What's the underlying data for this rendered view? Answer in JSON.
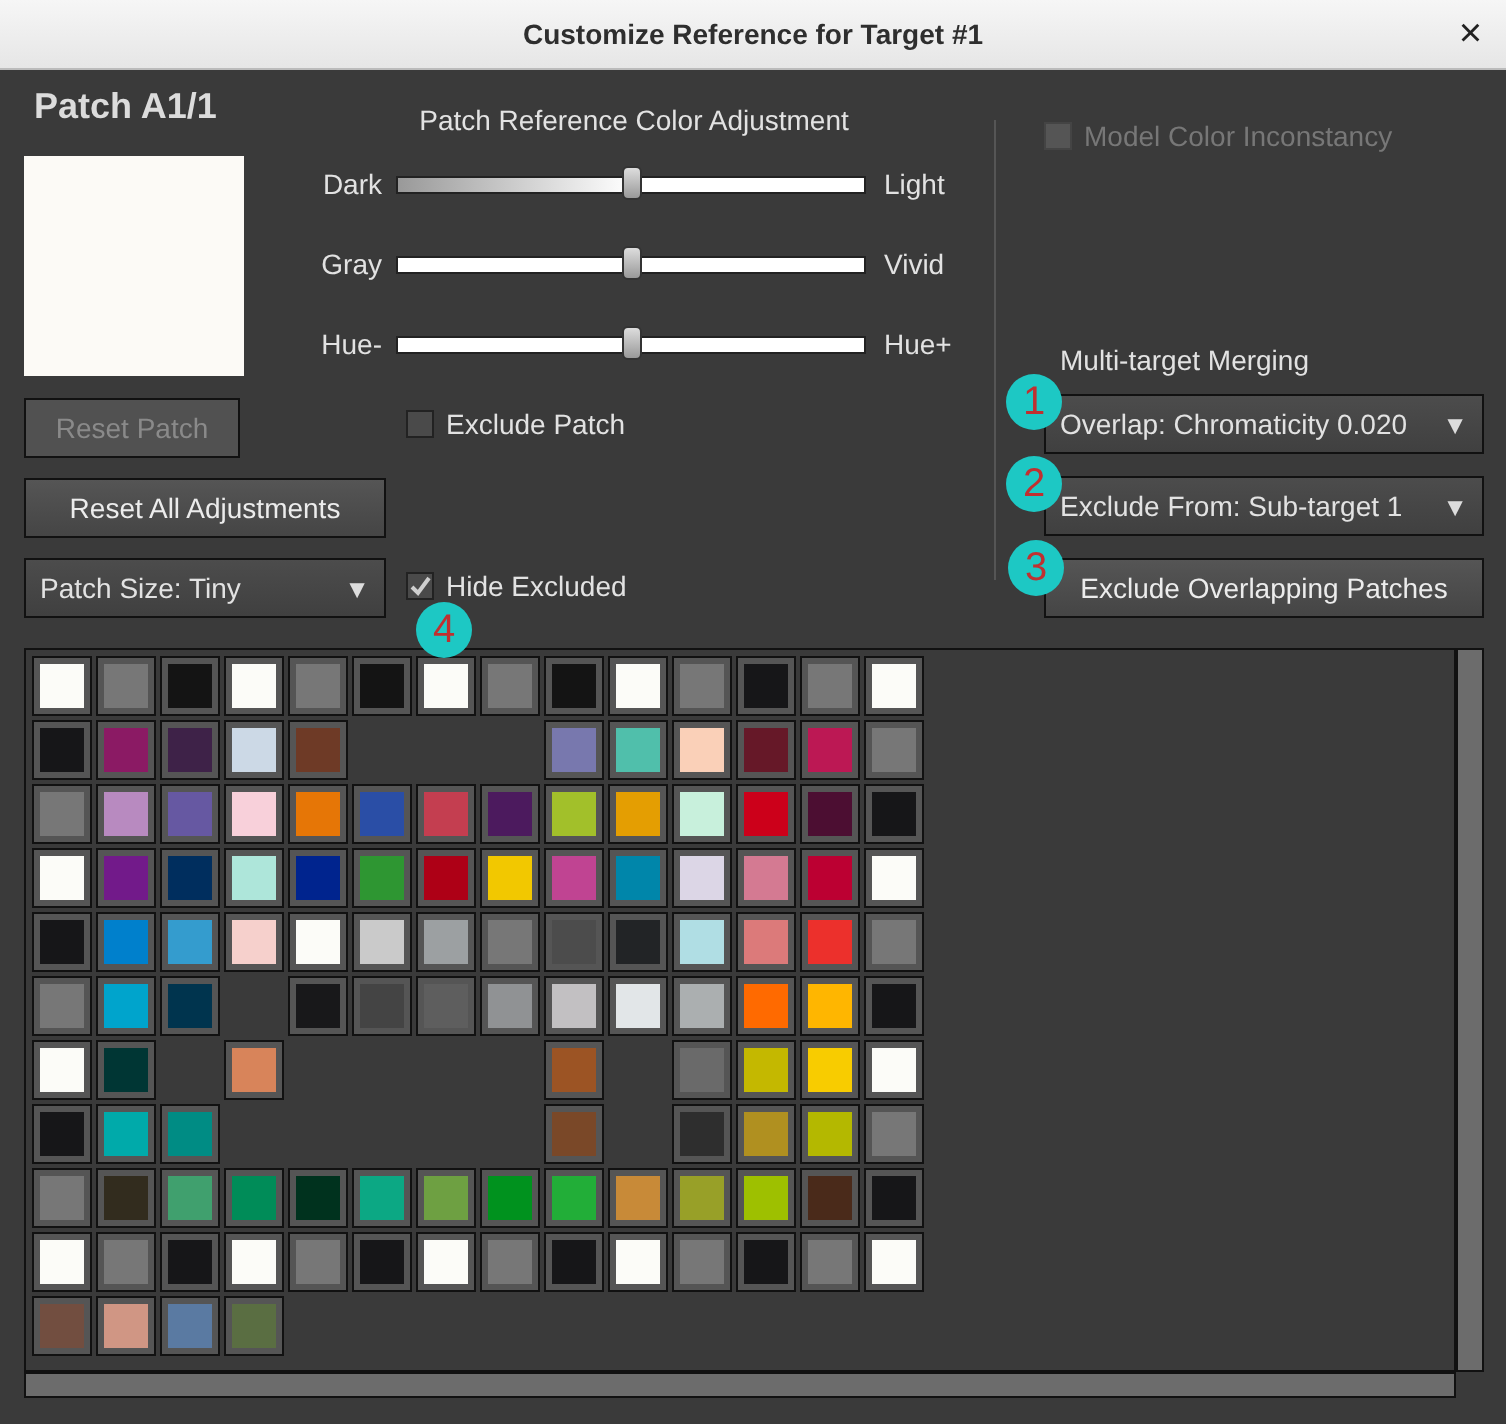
{
  "window": {
    "title": "Customize Reference for Target #1",
    "close": "×"
  },
  "patch": {
    "title": "Patch A1/1",
    "color": "#fcfaf6"
  },
  "buttons_left": [
    {
      "label": "Reset Patch",
      "disabled": true
    },
    {
      "label": "Reset All Adjustments",
      "disabled": false
    }
  ],
  "patch_size": {
    "value": "Patch Size: Tiny",
    "arrow": "▼"
  },
  "adjustment": {
    "title": "Patch Reference Color Adjustment",
    "sliders": [
      {
        "left": "Dark",
        "right": "Light",
        "level": 0.5,
        "kind": "gradient"
      },
      {
        "left": "Gray",
        "right": "Vivid",
        "level": 0.5,
        "kind": "plain"
      },
      {
        "left": "Hue-",
        "right": "Hue+",
        "level": 0.5,
        "kind": "plain"
      }
    ],
    "checkboxes": [
      {
        "label": "Exclude Patch",
        "checked": false
      },
      {
        "label": "Hide Excluded",
        "checked": true
      }
    ]
  },
  "model_color_inconstancy": {
    "label": "Model Color Inconstancy",
    "checked": false,
    "disabled": true
  },
  "merging": {
    "title": "Multi-target Merging",
    "controls": [
      {
        "kind": "dropdown",
        "label": "Overlap: Chromaticity 0.020",
        "arrow": "▼"
      },
      {
        "kind": "dropdown",
        "label": "Exclude From: Sub-target 1",
        "arrow": "▼"
      },
      {
        "kind": "button",
        "label": "Exclude Overlapping Patches"
      }
    ]
  },
  "annotations": [
    {
      "label": "1"
    },
    {
      "label": "2"
    },
    {
      "label": "3"
    },
    {
      "label": "4"
    }
  ],
  "patch_grid": [
    [
      {
        "kind": "patch",
        "color": "#fcfcf8"
      },
      {
        "kind": "patch",
        "color": "#777777"
      },
      {
        "kind": "patch",
        "color": "#141414"
      },
      {
        "kind": "patch",
        "color": "#fcfcf8"
      },
      {
        "kind": "patch",
        "color": "#777777"
      },
      {
        "kind": "patch",
        "color": "#141414"
      },
      {
        "kind": "patch",
        "color": "#fcfcf8"
      },
      {
        "kind": "patch",
        "color": "#777777"
      },
      {
        "kind": "patch",
        "color": "#141414"
      },
      {
        "kind": "patch",
        "color": "#fcfcf8"
      },
      {
        "kind": "patch",
        "color": "#777777"
      },
      {
        "kind": "patch",
        "color": "#161618"
      },
      {
        "kind": "patch",
        "color": "#777777"
      },
      {
        "kind": "patch",
        "color": "#fcfcf8"
      }
    ],
    [
      {
        "kind": "patch",
        "color": "#161618"
      },
      {
        "kind": "patch",
        "color": "#8b1a64"
      },
      {
        "kind": "patch",
        "color": "#3e2248"
      },
      {
        "kind": "patch",
        "color": "#ccd9e6"
      },
      {
        "kind": "patch",
        "color": "#6e3a26"
      },
      {
        "kind": "empty"
      },
      {
        "kind": "empty"
      },
      {
        "kind": "empty"
      },
      {
        "kind": "patch",
        "color": "#7878ae"
      },
      {
        "kind": "patch",
        "color": "#50bfab"
      },
      {
        "kind": "patch",
        "color": "#fad0b8"
      },
      {
        "kind": "patch",
        "color": "#661828"
      },
      {
        "kind": "patch",
        "color": "#bc1854"
      },
      {
        "kind": "patch",
        "color": "#777777"
      }
    ],
    [
      {
        "kind": "patch",
        "color": "#777777"
      },
      {
        "kind": "patch",
        "color": "#b88ac0"
      },
      {
        "kind": "patch",
        "color": "#6658a2"
      },
      {
        "kind": "patch",
        "color": "#f8d0da"
      },
      {
        "kind": "patch",
        "color": "#e67606"
      },
      {
        "kind": "patch",
        "color": "#2a4ea6"
      },
      {
        "kind": "patch",
        "color": "#c43e50"
      },
      {
        "kind": "patch",
        "color": "#4c1a5e"
      },
      {
        "kind": "patch",
        "color": "#a2c02a"
      },
      {
        "kind": "patch",
        "color": "#e49e02"
      },
      {
        "kind": "patch",
        "color": "#c8f0dc"
      },
      {
        "kind": "patch",
        "color": "#cc001a"
      },
      {
        "kind": "patch",
        "color": "#4c0e32"
      },
      {
        "kind": "patch",
        "color": "#161618"
      }
    ],
    [
      {
        "kind": "patch",
        "color": "#fcfcf8"
      },
      {
        "kind": "patch",
        "color": "#721a8a"
      },
      {
        "kind": "patch",
        "color": "#002e5e"
      },
      {
        "kind": "patch",
        "color": "#aee6da"
      },
      {
        "kind": "patch",
        "color": "#00248e"
      },
      {
        "kind": "patch",
        "color": "#2e9632"
      },
      {
        "kind": "patch",
        "color": "#ae0016"
      },
      {
        "kind": "patch",
        "color": "#f2c800"
      },
      {
        "kind": "patch",
        "color": "#c04492"
      },
      {
        "kind": "patch",
        "color": "#0086aa"
      },
      {
        "kind": "patch",
        "color": "#dcd6e6"
      },
      {
        "kind": "patch",
        "color": "#d47a92"
      },
      {
        "kind": "patch",
        "color": "#bc0032"
      },
      {
        "kind": "patch",
        "color": "#fcfcf8"
      }
    ],
    [
      {
        "kind": "patch",
        "color": "#161618"
      },
      {
        "kind": "patch",
        "color": "#0080cc"
      },
      {
        "kind": "patch",
        "color": "#349cce"
      },
      {
        "kind": "patch",
        "color": "#f6d0cc"
      },
      {
        "kind": "patch",
        "color": "#fcfcf8"
      },
      {
        "kind": "patch",
        "color": "#cacaca"
      },
      {
        "kind": "patch",
        "color": "#9ca0a2"
      },
      {
        "kind": "patch",
        "color": "#777777"
      },
      {
        "kind": "patch",
        "color": "#4c4c4c"
      },
      {
        "kind": "patch",
        "color": "#222426"
      },
      {
        "kind": "patch",
        "color": "#b0dee4"
      },
      {
        "kind": "patch",
        "color": "#dc7a7a"
      },
      {
        "kind": "patch",
        "color": "#ec302c"
      },
      {
        "kind": "patch",
        "color": "#777777"
      }
    ],
    [
      {
        "kind": "patch",
        "color": "#777777"
      },
      {
        "kind": "patch",
        "color": "#00a4cc"
      },
      {
        "kind": "patch",
        "color": "#00344e"
      },
      {
        "kind": "empty"
      },
      {
        "kind": "patch",
        "color": "#18181a"
      },
      {
        "kind": "patch",
        "color": "#444444"
      },
      {
        "kind": "patch",
        "color": "#5e5e5e"
      },
      {
        "kind": "patch",
        "color": "#909294"
      },
      {
        "kind": "patch",
        "color": "#c2c0c2"
      },
      {
        "kind": "patch",
        "color": "#e2e6e8"
      },
      {
        "kind": "patch",
        "color": "#abafb0"
      },
      {
        "kind": "patch",
        "color": "#ff6a00"
      },
      {
        "kind": "patch",
        "color": "#ffb600"
      },
      {
        "kind": "patch",
        "color": "#161618"
      }
    ],
    [
      {
        "kind": "patch",
        "color": "#fcfcf8"
      },
      {
        "kind": "patch",
        "color": "#003634"
      },
      {
        "kind": "empty"
      },
      {
        "kind": "patch",
        "color": "#d8845a"
      },
      {
        "kind": "empty"
      },
      {
        "kind": "empty"
      },
      {
        "kind": "empty"
      },
      {
        "kind": "empty"
      },
      {
        "kind": "patch",
        "color": "#9c5424"
      },
      {
        "kind": "empty"
      },
      {
        "kind": "patch",
        "color": "#6a6a6a"
      },
      {
        "kind": "patch",
        "color": "#c4b800"
      },
      {
        "kind": "patch",
        "color": "#f8cc00"
      },
      {
        "kind": "patch",
        "color": "#fcfcf8"
      }
    ],
    [
      {
        "kind": "patch",
        "color": "#161618"
      },
      {
        "kind": "patch",
        "color": "#00aaaa"
      },
      {
        "kind": "patch",
        "color": "#008c84"
      },
      {
        "kind": "empty"
      },
      {
        "kind": "empty"
      },
      {
        "kind": "empty"
      },
      {
        "kind": "empty"
      },
      {
        "kind": "empty"
      },
      {
        "kind": "patch",
        "color": "#7a4828"
      },
      {
        "kind": "empty"
      },
      {
        "kind": "patch",
        "color": "#2e2e2e"
      },
      {
        "kind": "patch",
        "color": "#b09020"
      },
      {
        "kind": "patch",
        "color": "#b4b800"
      },
      {
        "kind": "patch",
        "color": "#777777"
      }
    ],
    [
      {
        "kind": "patch",
        "color": "#777777"
      },
      {
        "kind": "patch",
        "color": "#322c1e"
      },
      {
        "kind": "patch",
        "color": "#40a06e"
      },
      {
        "kind": "patch",
        "color": "#008c58"
      },
      {
        "kind": "patch",
        "color": "#00321e"
      },
      {
        "kind": "patch",
        "color": "#0ca884"
      },
      {
        "kind": "patch",
        "color": "#6ea042"
      },
      {
        "kind": "patch",
        "color": "#00921e"
      },
      {
        "kind": "patch",
        "color": "#22ae38"
      },
      {
        "kind": "patch",
        "color": "#c88a38"
      },
      {
        "kind": "patch",
        "color": "#98a028"
      },
      {
        "kind": "patch",
        "color": "#9ec000"
      },
      {
        "kind": "patch",
        "color": "#4a2a1a"
      },
      {
        "kind": "patch",
        "color": "#161618"
      }
    ],
    [
      {
        "kind": "patch",
        "color": "#fcfcf8"
      },
      {
        "kind": "patch",
        "color": "#777777"
      },
      {
        "kind": "patch",
        "color": "#161618"
      },
      {
        "kind": "patch",
        "color": "#fcfcf8"
      },
      {
        "kind": "patch",
        "color": "#777777"
      },
      {
        "kind": "patch",
        "color": "#161618"
      },
      {
        "kind": "patch",
        "color": "#fcfcf8"
      },
      {
        "kind": "patch",
        "color": "#777777"
      },
      {
        "kind": "patch",
        "color": "#161618"
      },
      {
        "kind": "patch",
        "color": "#fcfcf8"
      },
      {
        "kind": "patch",
        "color": "#777777"
      },
      {
        "kind": "patch",
        "color": "#161618"
      },
      {
        "kind": "patch",
        "color": "#777777"
      },
      {
        "kind": "patch",
        "color": "#fcfcf8"
      }
    ],
    [
      {
        "kind": "patch",
        "color": "#724e40"
      },
      {
        "kind": "patch",
        "color": "#d09684"
      },
      {
        "kind": "patch",
        "color": "#5a7aa2"
      },
      {
        "kind": "patch",
        "color": "#5a6e42"
      }
    ]
  ]
}
